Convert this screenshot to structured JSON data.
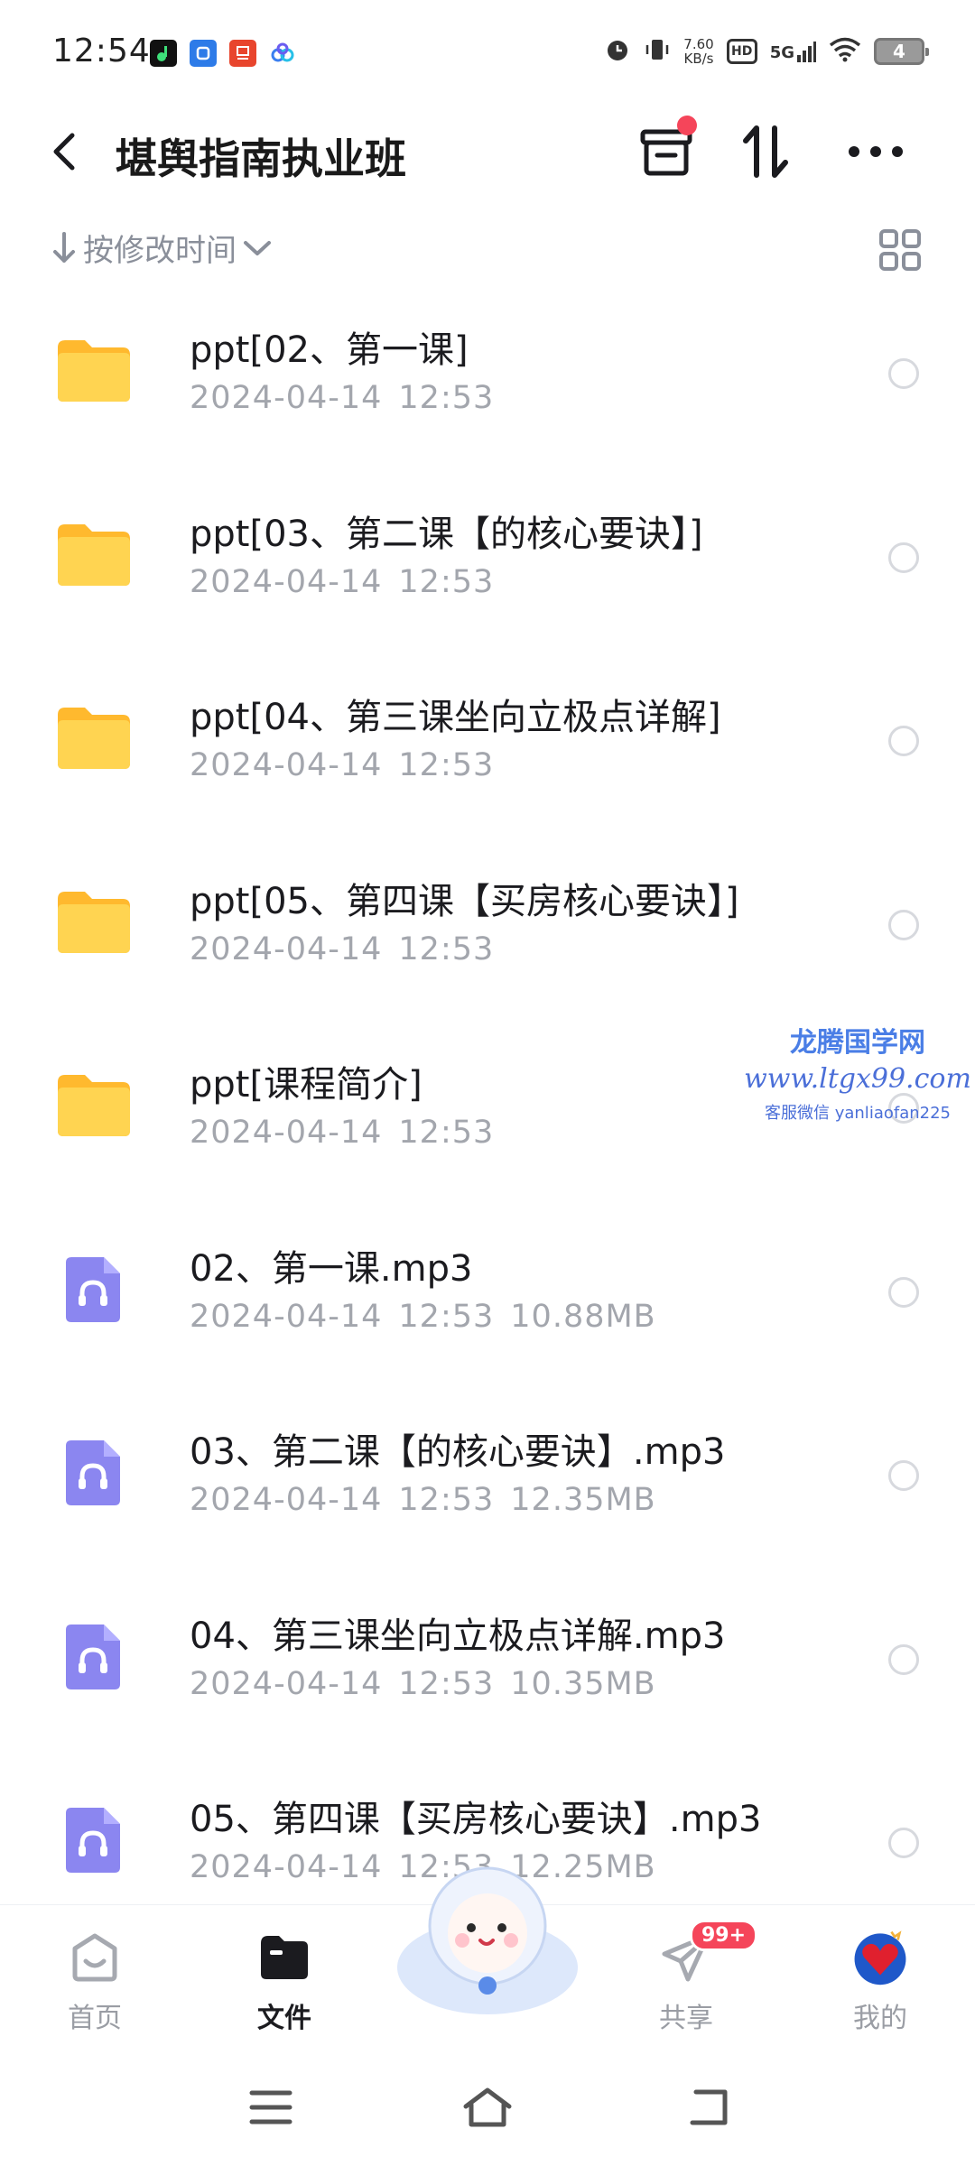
{
  "status_bar": {
    "time": "12:54",
    "speed_value": "7.60",
    "speed_unit": "KB/s",
    "hd": "HD",
    "network": "5G",
    "battery": "4"
  },
  "header": {
    "title": "堪舆指南执业班"
  },
  "sort": {
    "label": "按修改时间"
  },
  "files": [
    {
      "type": "folder",
      "name": "ppt[02、第一课]",
      "date": "2024-04-14",
      "time": "12:53",
      "size": ""
    },
    {
      "type": "folder",
      "name": "ppt[03、第二课【的核心要诀】]",
      "date": "2024-04-14",
      "time": "12:53",
      "size": ""
    },
    {
      "type": "folder",
      "name": "ppt[04、第三课坐向立极点详解]",
      "date": "2024-04-14",
      "time": "12:53",
      "size": ""
    },
    {
      "type": "folder",
      "name": "ppt[05、第四课【买房核心要诀】]",
      "date": "2024-04-14",
      "time": "12:53",
      "size": ""
    },
    {
      "type": "folder",
      "name": "ppt[课程简介]",
      "date": "2024-04-14",
      "time": "12:53",
      "size": ""
    },
    {
      "type": "audio",
      "name": "02、第一课.mp3",
      "date": "2024-04-14",
      "time": "12:53",
      "size": "10.88MB"
    },
    {
      "type": "audio",
      "name": "03、第二课【的核心要诀】.mp3",
      "date": "2024-04-14",
      "time": "12:53",
      "size": "12.35MB"
    },
    {
      "type": "audio",
      "name": "04、第三课坐向立极点详解.mp3",
      "date": "2024-04-14",
      "time": "12:53",
      "size": "10.35MB"
    },
    {
      "type": "audio",
      "name": "05、第四课【买房核心要诀】.mp3",
      "date": "2024-04-14",
      "time": "12:53",
      "size": "12.25MB"
    }
  ],
  "watermark": {
    "line1": "龙腾国学网",
    "line2": "www.ltgx99.com",
    "line3": "客服微信 yanliaofan225"
  },
  "bottom_nav": {
    "home": "首页",
    "files": "文件",
    "share": "共享",
    "share_badge": "99+",
    "mine": "我的"
  },
  "colors": {
    "folder": "#ffc93c",
    "audio_icon": "#8b86f0",
    "accent_red": "#f5455a",
    "watermark": "#4a7ee6"
  }
}
